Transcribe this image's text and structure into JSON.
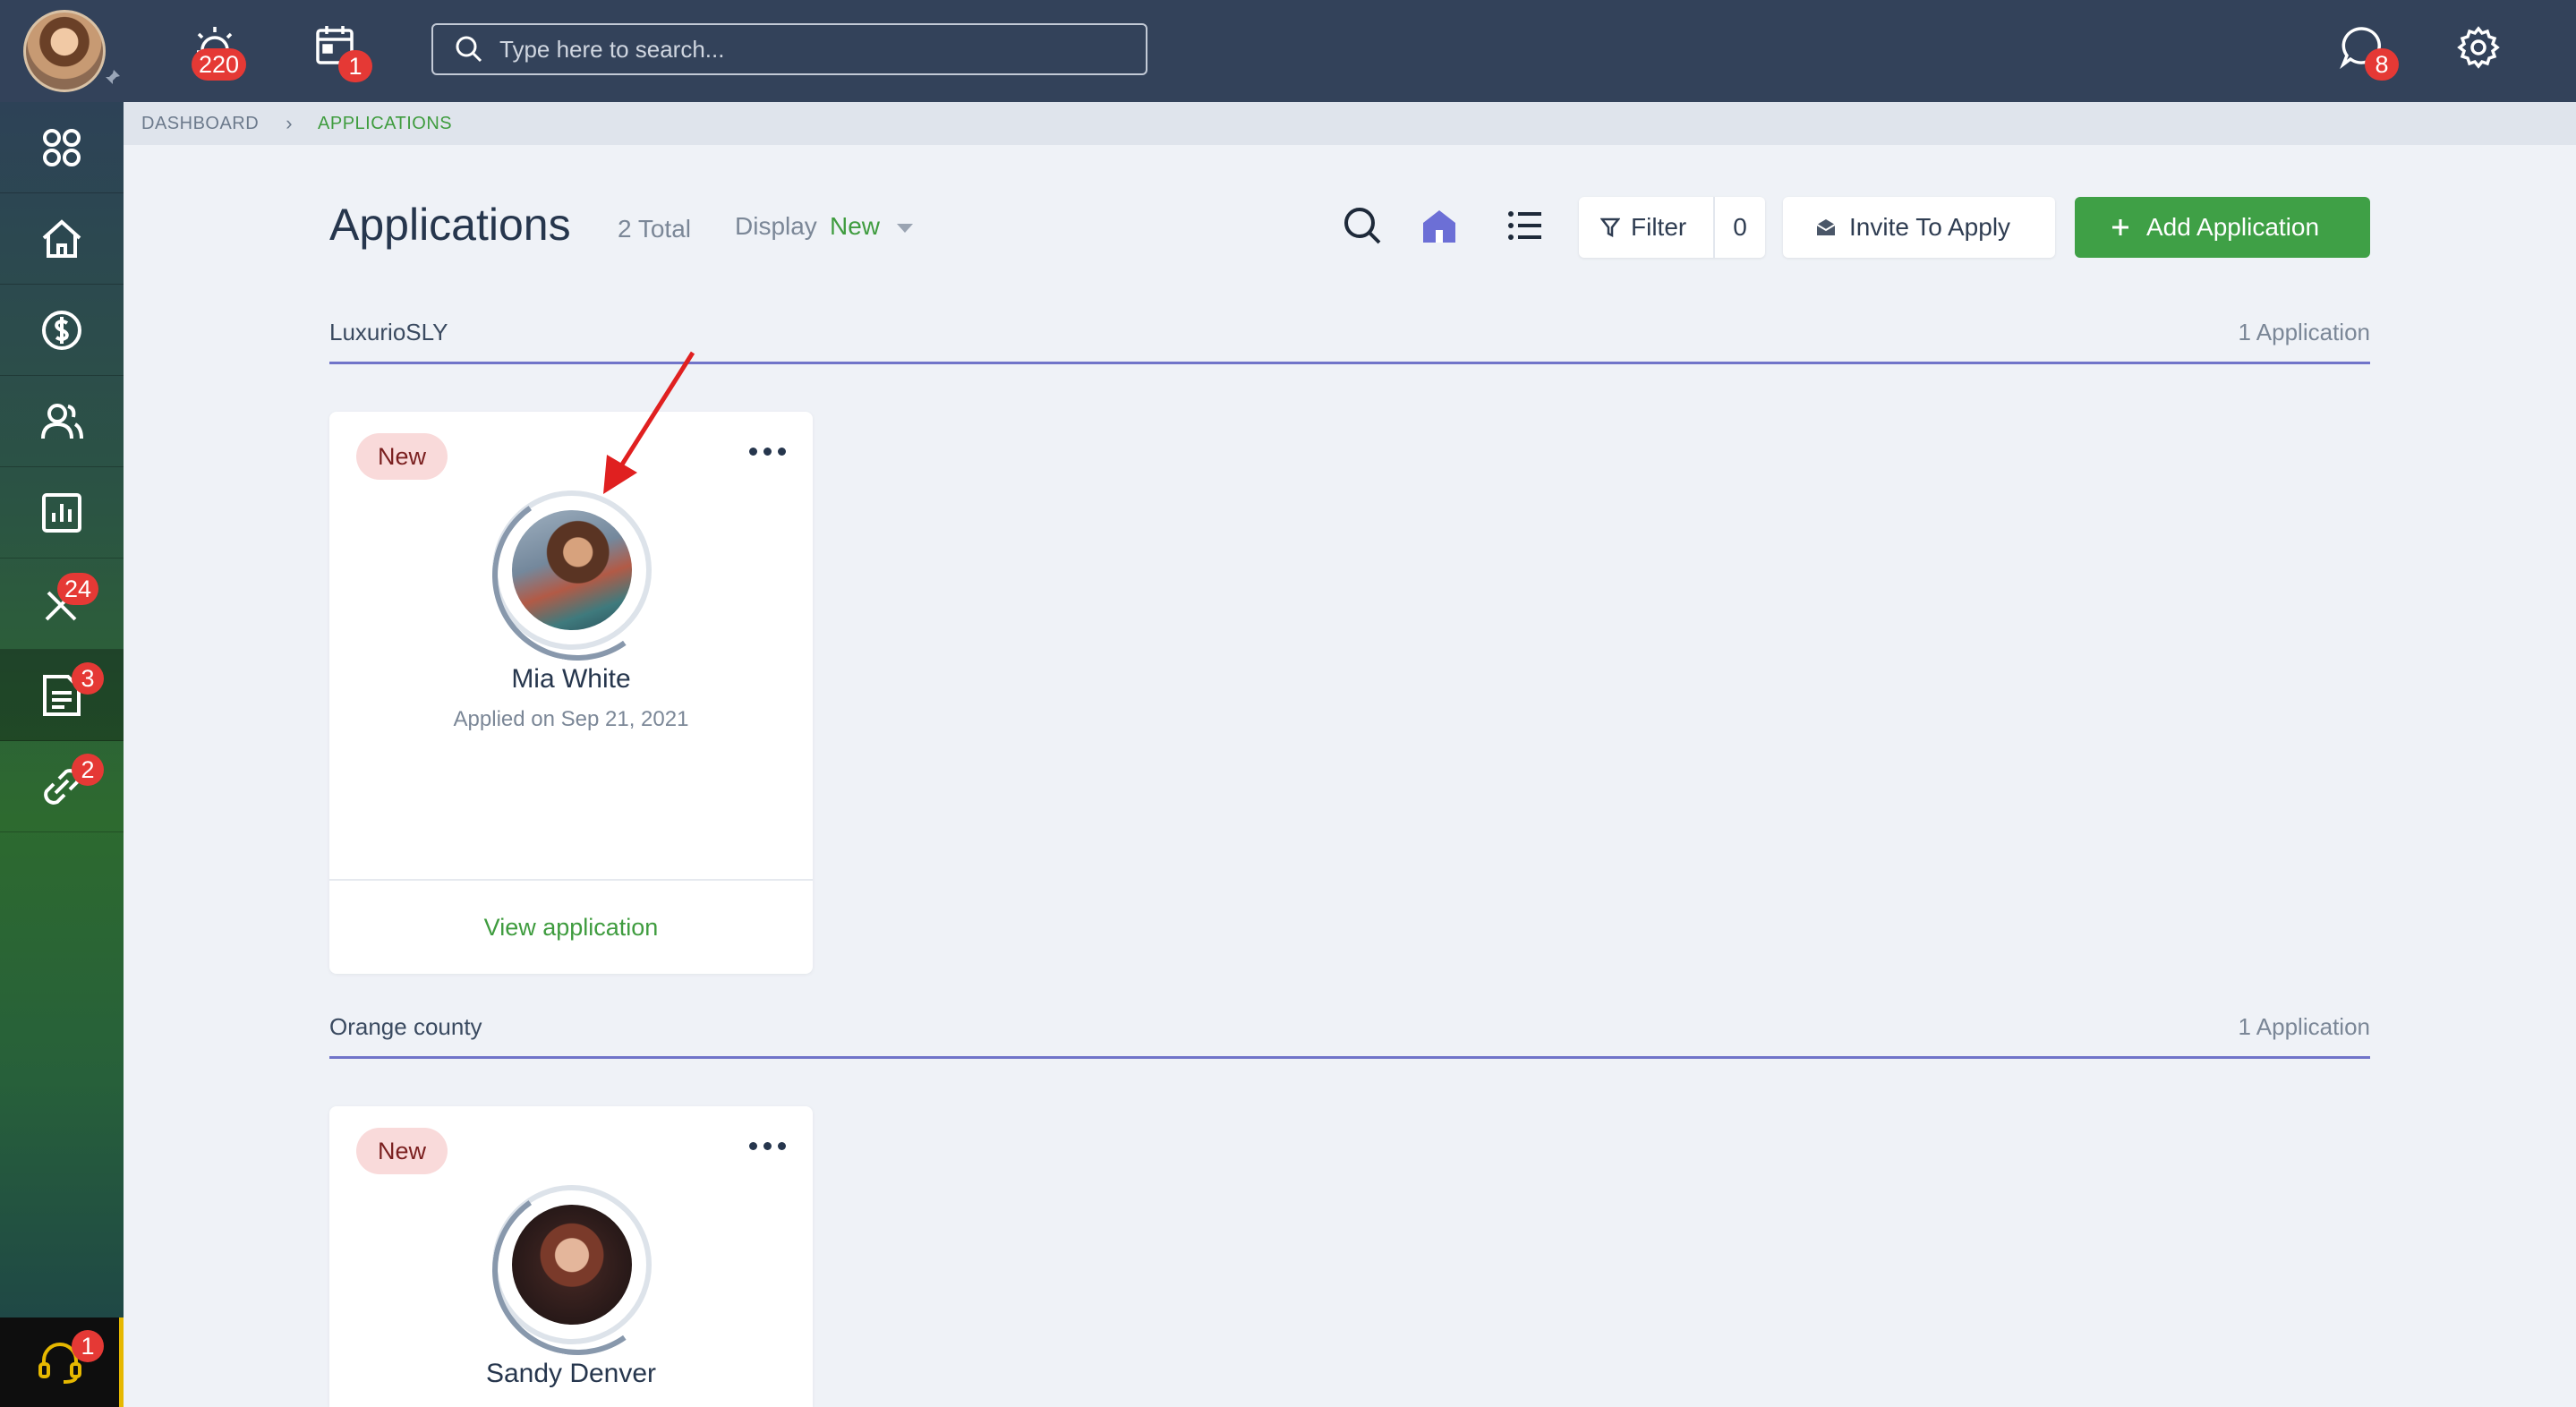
{
  "topbar": {
    "notifications_count": "220",
    "calendar_count": "1",
    "search_placeholder": "Type here to search...",
    "messages_count": "8"
  },
  "sidebar": {
    "tools_count": "24",
    "applications_count": "3",
    "links_count": "2",
    "support_count": "1"
  },
  "breadcrumb": {
    "dashboard": "DASHBOARD",
    "current": "APPLICATIONS"
  },
  "header": {
    "title": "Applications",
    "total": "2 Total",
    "display_label": "Display",
    "display_value": "New",
    "filter_label": "Filter",
    "filter_count": "0",
    "invite_label": "Invite To Apply",
    "add_label": "Add Application"
  },
  "groups": [
    {
      "name": "LuxurioSLY",
      "count": "1 Application",
      "card": {
        "status": "New",
        "name": "Mia White",
        "applied": "Applied on Sep 21, 2021",
        "view_label": "View application"
      }
    },
    {
      "name": "Orange county",
      "count": "1 Application",
      "card": {
        "status": "New",
        "name": "Sandy Denver"
      }
    }
  ],
  "colors": {
    "topbar": "#33425a",
    "accent_green": "#3fa046",
    "badge_red": "#e53935",
    "group_line": "#7074c9"
  }
}
